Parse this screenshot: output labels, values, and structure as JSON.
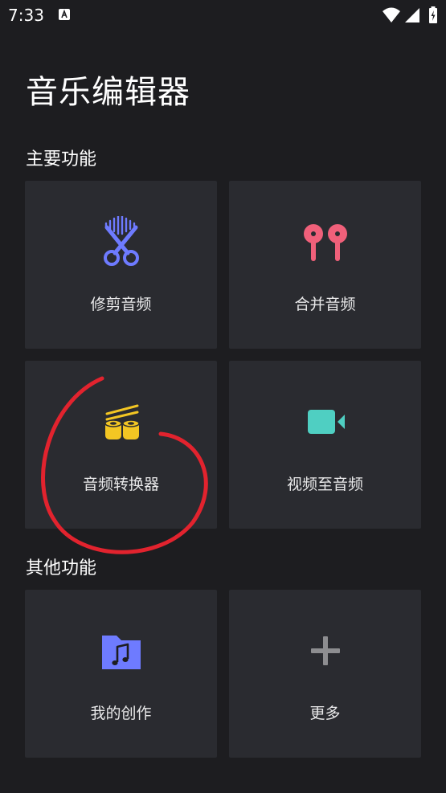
{
  "status_bar": {
    "time": "7:33",
    "icons": [
      "a-icon",
      "wifi-icon",
      "signal-icon",
      "battery-charging-icon"
    ]
  },
  "app": {
    "title": "音乐编辑器"
  },
  "sections": {
    "main": {
      "title": "主要功能",
      "cards": [
        {
          "label": "修剪音频",
          "icon": "scissors-waveform-icon",
          "color": "#6e7bff"
        },
        {
          "label": "合并音频",
          "icon": "earbuds-icon",
          "color": "#f0607a"
        },
        {
          "label": "音频转换器",
          "icon": "film-reels-icon",
          "color": "#f3c623"
        },
        {
          "label": "视频至音频",
          "icon": "video-camera-icon",
          "color": "#4fcfc2"
        }
      ]
    },
    "other": {
      "title": "其他功能",
      "cards": [
        {
          "label": "我的创作",
          "icon": "music-folder-icon",
          "color": "#6e7bff"
        },
        {
          "label": "更多",
          "icon": "plus-icon",
          "color": "#8d8d90"
        }
      ]
    }
  },
  "colors": {
    "background": "#1d1d20",
    "card": "#2a2b30",
    "annotation": "#e2232e"
  }
}
